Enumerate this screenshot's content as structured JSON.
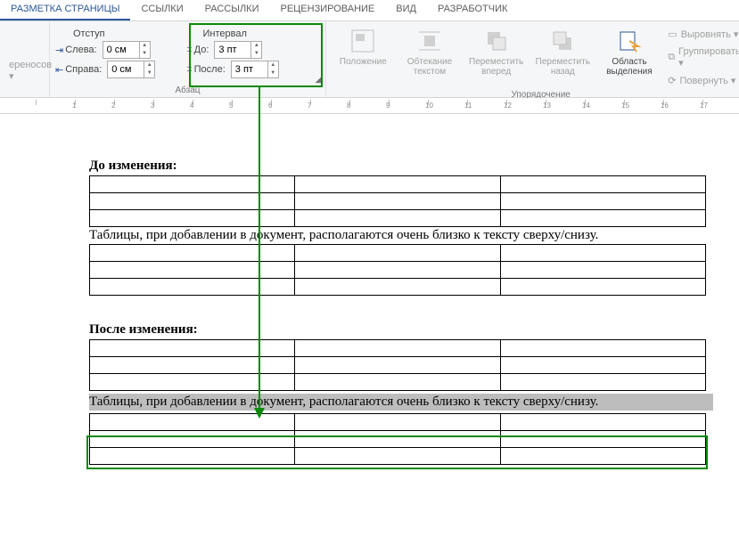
{
  "tabs": {
    "page_layout": "РАЗМЕТКА СТРАНИЦЫ",
    "links": "ССЫЛКИ",
    "mailings": "РАССЫЛКИ",
    "review": "РЕЦЕНЗИРОВАНИЕ",
    "view": "ВИД",
    "developer": "РАЗРАБОТЧИК"
  },
  "hyphenation_fragment": "ереносов ▾",
  "indent": {
    "title": "Отступ",
    "left_label": "Слева:",
    "right_label": "Справа:",
    "left_value": "0 см",
    "right_value": "0 см"
  },
  "spacing": {
    "title": "Интервал",
    "before_label": "До:",
    "after_label": "После:",
    "before_value": "3 пт",
    "after_value": "3 пт"
  },
  "paragraph_group": "Абзац",
  "arrange": {
    "position": "Положение",
    "wrap": "Обтекание текстом",
    "forward": "Переместить вперед",
    "backward": "Переместить назад",
    "selection_pane": "Область выделения",
    "align": "Выровнять ▾",
    "group": "Группировать ▾",
    "rotate": "Повернуть ▾",
    "group_title": "Упорядочение"
  },
  "ruler_marks": [
    "",
    "1",
    "2",
    "3",
    "4",
    "5",
    "6",
    "7",
    "8",
    "9",
    "10",
    "11",
    "12",
    "13",
    "14",
    "15",
    "16",
    "17"
  ],
  "doc": {
    "before_heading": "До изменения:",
    "after_heading": "После изменения:",
    "sentence": "Таблицы, при добавлении в документ, располагаются очень близко к тексту сверху/снизу."
  }
}
